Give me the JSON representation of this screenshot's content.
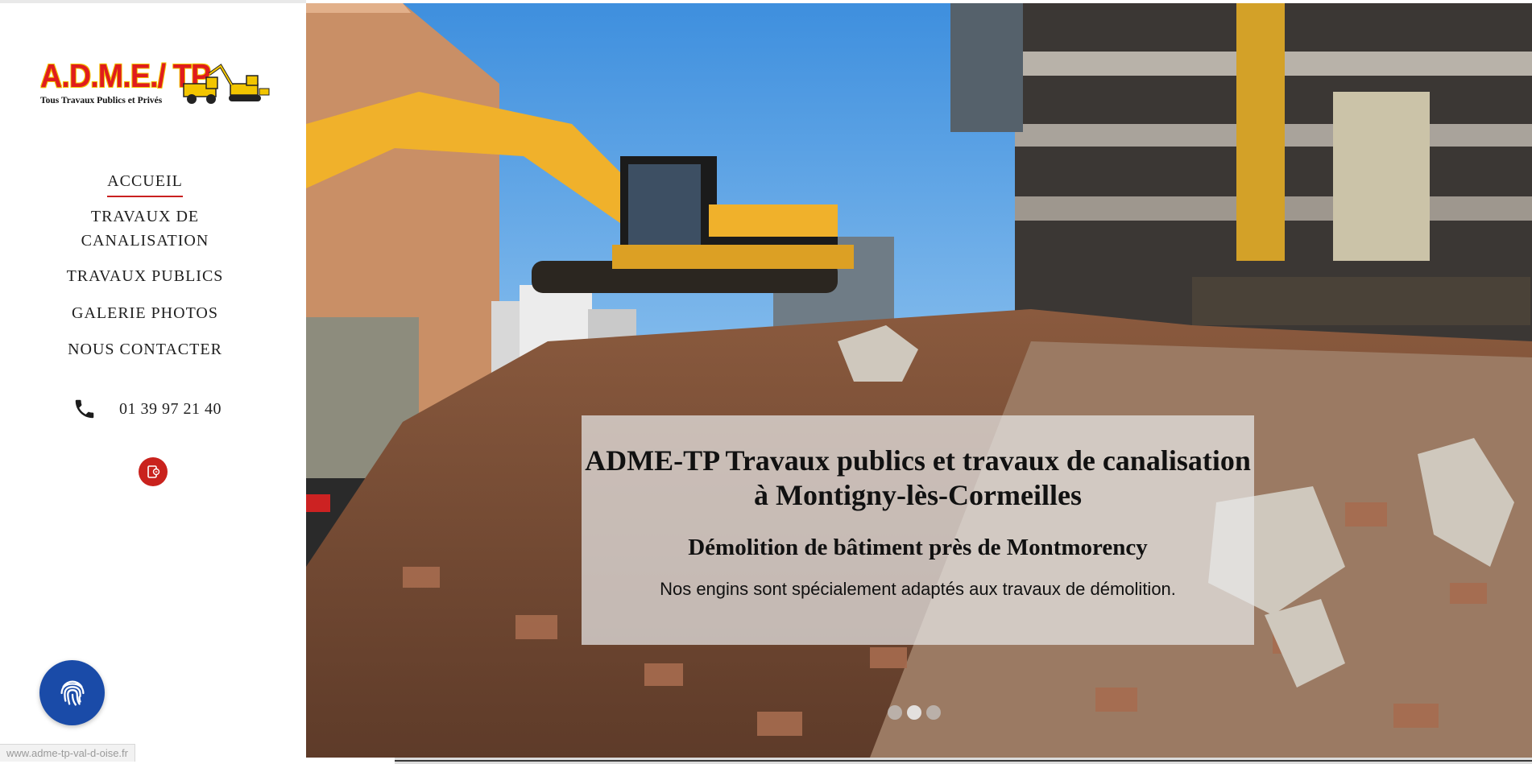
{
  "brand": {
    "logo_text": "A.D.M.E./ TP",
    "tagline": "Tous Travaux Publics et Privés"
  },
  "nav": {
    "items": [
      {
        "label": "ACCUEIL",
        "active": true
      },
      {
        "label": "TRAVAUX DE CANALISATION",
        "active": false
      },
      {
        "label": "TRAVAUX PUBLICS",
        "active": false
      },
      {
        "label": "GALERIE PHOTOS",
        "active": false
      },
      {
        "label": "NOUS CONTACTER",
        "active": false
      }
    ]
  },
  "contact": {
    "phone": "01 39 97 21 40",
    "phone_icon": "phone-icon",
    "badge_icon": "contact-card-icon"
  },
  "hero": {
    "title": "ADME-TP Travaux publics et travaux de canalisation à Montigny-lès-Cormeilles",
    "subtitle": "Démolition de bâtiment près de Montmorency",
    "text": "Nos engins sont spécialement adaptés aux travaux de démolition.",
    "slide_count": 3,
    "active_slide": 2
  },
  "floating_button": {
    "icon": "fingerprint-icon"
  },
  "status_bar": {
    "url": "www.adme-tp-val-d-oise.fr"
  },
  "colors": {
    "accent": "#c92020",
    "fingerprint_button": "#1a4ba8",
    "logo_red": "#e01d1d",
    "logo_yellow": "#f2c500"
  }
}
